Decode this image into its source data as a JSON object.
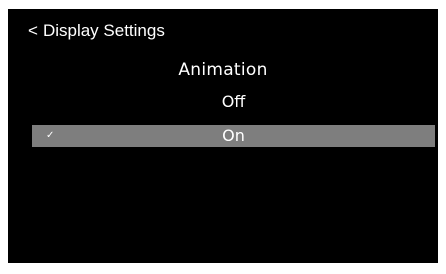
{
  "header": {
    "back_symbol": "<",
    "title": "Display Settings"
  },
  "section": {
    "title": "Animation"
  },
  "options": [
    {
      "label": "Off",
      "selected": false
    },
    {
      "label": "On",
      "selected": true,
      "check_mark": "✓"
    }
  ],
  "colors": {
    "background": "#000000",
    "text": "#ffffff",
    "selection_highlight": "#7e7e7e"
  }
}
